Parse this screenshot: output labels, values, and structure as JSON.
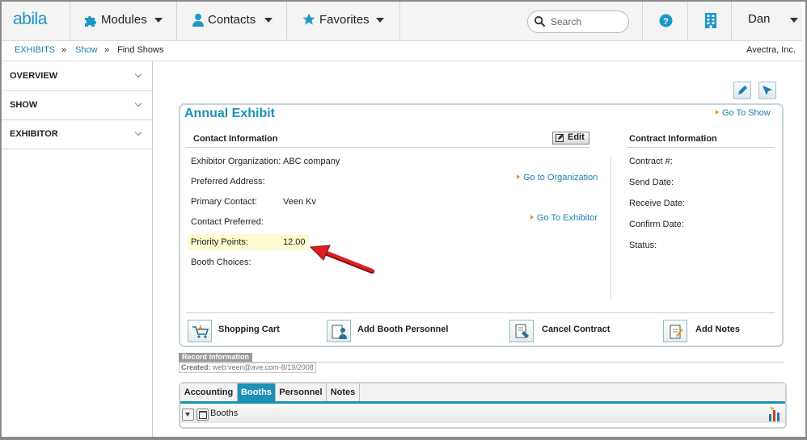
{
  "app": {
    "logo": "abila",
    "brand_color": "#1b98c9"
  },
  "nav": {
    "modules": "Modules",
    "contacts": "Contacts",
    "favorites": "Favorites",
    "search_placeholder": "Search",
    "user": "Dan",
    "icons": [
      "puzzle-icon",
      "person-icon",
      "star-icon",
      "search-icon",
      "help-icon",
      "building-icon"
    ]
  },
  "breadcrumb": {
    "items": [
      "EXHIBITS",
      "Show",
      "Find Shows"
    ],
    "separator": "»",
    "org": "Avectra, Inc."
  },
  "sidebar": {
    "items": [
      {
        "label": "OVERVIEW"
      },
      {
        "label": "SHOW"
      },
      {
        "label": "EXHIBITOR"
      }
    ]
  },
  "panel": {
    "title": "Annual Exhibit",
    "go_to_show": "Go To Show",
    "contact_header": "Contact Information",
    "edit_label": "Edit",
    "contract_header": "Contract Information",
    "fields": {
      "exhibitor_org_label": "Exhibitor Organization:",
      "exhibitor_org_value": "ABC company",
      "preferred_address_label": "Preferred Address:",
      "primary_contact_label": "Primary Contact:",
      "primary_contact_value": "Veen Kv",
      "contact_preferred_label": "Contact Preferred:",
      "priority_points_label": "Priority Points:",
      "priority_points_value": "12.00",
      "booth_choices_label": "Booth Choices:"
    },
    "links": {
      "go_to_org": "Go to Organization",
      "go_to_exhibitor": "Go To Exhibitor"
    },
    "contract_fields": [
      "Contract #:",
      "Send Date:",
      "Receive Date:",
      "Confirm Date:",
      "Status:"
    ],
    "actions": [
      {
        "label": "Shopping Cart",
        "icon": "shopping-cart-icon"
      },
      {
        "label": "Add Booth Personnel",
        "icon": "add-personnel-icon"
      },
      {
        "label": "Cancel Contract",
        "icon": "cancel-contract-icon"
      },
      {
        "label": "Add Notes",
        "icon": "add-notes-icon"
      }
    ]
  },
  "record_info": {
    "label": "Record Information",
    "created_label": "Created:",
    "created_value": "web:veen@ave.com-8/19/2008"
  },
  "tabs": {
    "items": [
      "Accounting",
      "Booths",
      "Personnel",
      "Notes"
    ],
    "active": "Booths",
    "active_color": "#1c91b5",
    "section_title": "Booths"
  },
  "annotation": {
    "arrow_color": "#e02020",
    "highlight_color": "#fdfbd0"
  }
}
